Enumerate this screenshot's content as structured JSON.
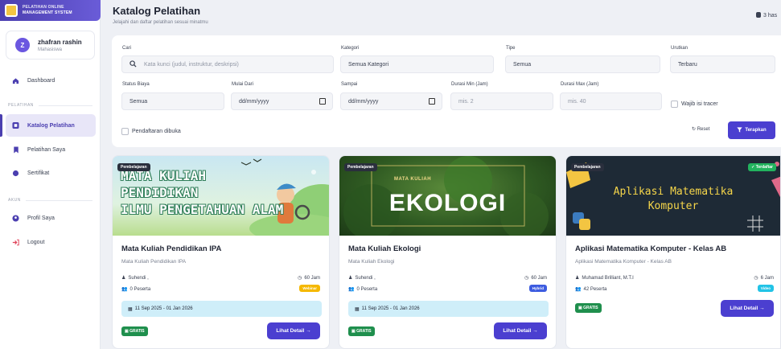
{
  "sidebar": {
    "brand_line1": "PELATIHAN ONLINE",
    "brand_line2": "MANAGEMENT SYSTEM",
    "user_initial": "Z",
    "user_name": "zhafran rashin",
    "user_role": "Mahasiswa",
    "section_pelatihan": "PELATIHAN",
    "section_akun": "AKUN",
    "items": [
      {
        "label": "Dashboard",
        "icon": "home-icon"
      },
      {
        "label": "Katalog Pelatihan",
        "icon": "catalog-icon",
        "active": true
      },
      {
        "label": "Pelatihan Saya",
        "icon": "bookmark-icon"
      },
      {
        "label": "Sertifikat",
        "icon": "certificate-icon"
      },
      {
        "label": "Profil Saya",
        "icon": "user-icon"
      },
      {
        "label": "Logout",
        "icon": "logout-icon"
      }
    ]
  },
  "header": {
    "title": "Katalog Pelatihan",
    "subtitle": "Jelajahi dan daftar pelatihan sesuai minatmu",
    "result_count": "3 has"
  },
  "filters": {
    "cari_label": "Cari",
    "cari_placeholder": "Kata kunci (judul, instruktur, deskripsi)",
    "kategori_label": "Kategori",
    "kategori_value": "Semua Kategori",
    "tipe_label": "Tipe",
    "tipe_value": "Semua",
    "urutkan_label": "Urutkan",
    "urutkan_value": "Terbaru",
    "status_label": "Status Biaya",
    "status_value": "Semua",
    "mulai_label": "Mulai Dari",
    "mulai_value": "dd/mm/yyyy",
    "sampai_label": "Sampai",
    "sampai_value": "dd/mm/yyyy",
    "durmin_label": "Durasi Min (Jam)",
    "durmin_placeholder": "mis. 2",
    "durmax_label": "Durasi Max (Jam)",
    "durmax_placeholder": "mis. 40",
    "wajib_tracer": "Wajib isi tracer",
    "pendaftaran_dibuka": "Pendaftaran dibuka",
    "reset_label": "Reset",
    "apply_label": "Terapkan"
  },
  "cards": [
    {
      "category": "Pembelajaran",
      "banner_line1": "MATA KULIAH",
      "banner_line2": "PENDIDIKAN",
      "banner_line3": "ILMU PENGETAHUAN ALAM",
      "title": "Mata Kuliah Pendidikan IPA",
      "subtitle": "Mata Kuliah Pendidikan IPA",
      "instructor": "Suhendi ,",
      "duration": "60 Jam",
      "participants": "0 Peserta",
      "mode": "Webinar",
      "mode_color": "#f5b800",
      "dates": "11 Sep 2025 - 01 Jan 2026",
      "price": "GRATIS",
      "detail": "Lihat Detail →"
    },
    {
      "category": "Pembelajaran",
      "banner_small": "MATA KULIAH",
      "banner_big": "EKOLOGI",
      "title": "Mata Kuliah Ekologi",
      "subtitle": "Mata Kuliah Ekologi",
      "instructor": "Suhendi ,",
      "duration": "60 Jam",
      "participants": "0 Peserta",
      "mode": "Hybrid",
      "mode_color": "#3d5ce0",
      "dates": "11 Sep 2025 - 01 Jan 2026",
      "price": "GRATIS",
      "detail": "Lihat Detail →"
    },
    {
      "category": "Pembelajaran",
      "registered": "✓ Terdaftar",
      "banner_line1": "Aplikasi Matematika",
      "banner_line2": "Komputer",
      "title": "Aplikasi Matematika Komputer - Kelas AB",
      "subtitle": "Aplikasi Matematika Komputer - Kelas AB",
      "instructor": "Muhamad Brilliant, M.T.I",
      "duration": "6 Jam",
      "participants": "42 Peserta",
      "mode": "Video",
      "mode_color": "#22c3e6",
      "price": "GRATIS",
      "detail": "Lihat Detail →"
    }
  ]
}
